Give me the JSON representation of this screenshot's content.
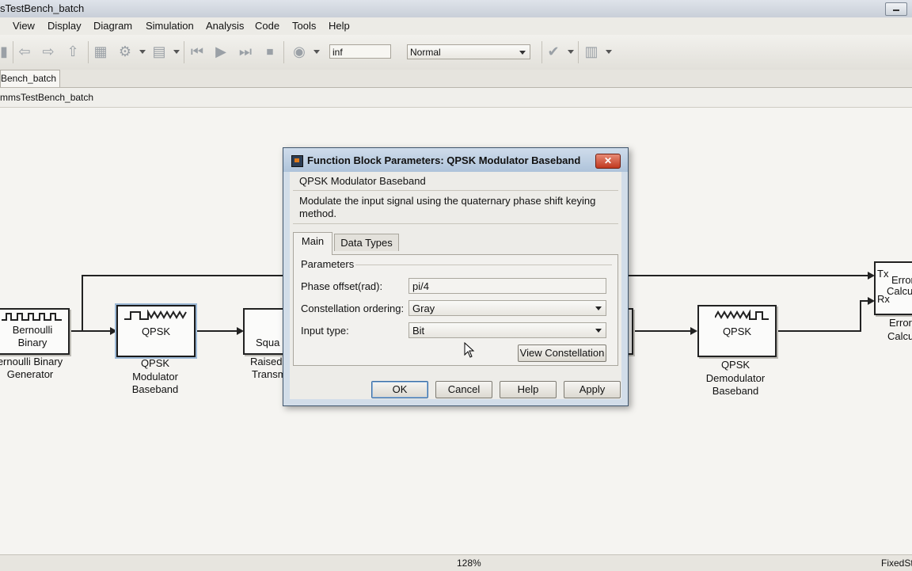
{
  "window": {
    "title": "sTestBench_batch"
  },
  "menus": [
    "View",
    "Display",
    "Diagram",
    "Simulation",
    "Analysis",
    "Code",
    "Tools",
    "Help"
  ],
  "toolbar": {
    "stop_time": "inf",
    "sim_mode": "Normal"
  },
  "tabs": {
    "model_tab": "Bench_batch"
  },
  "breadcrumb": "mmsTestBench_batch",
  "blocks": {
    "bernoulli": {
      "icon_text_1": "Bernoulli",
      "icon_text_2": "Binary",
      "label_1": "ernoulli Binary",
      "label_2": "Generator"
    },
    "qpsk_mod": {
      "icon_text": "QPSK",
      "label_1": "QPSK",
      "label_2": "Modulator",
      "label_3": "Baseband"
    },
    "raised_cosine": {
      "icon_text": "Squa",
      "label_1": "Raised",
      "label_2": "Transm"
    },
    "qpsk_demod": {
      "icon_text": "QPSK",
      "label_1": "QPSK",
      "label_2": "Demodulator",
      "label_3": "Baseband"
    },
    "error_rate": {
      "port_tx": "Tx",
      "port_rx": "Rx",
      "icon_text_1": "Error",
      "icon_text_2": "Calcu",
      "label_1": "Error",
      "label_2": "Calcu"
    }
  },
  "status": {
    "zoom": "128%",
    "solver": "FixedSt"
  },
  "dialog": {
    "title": "Function Block Parameters: QPSK Modulator Baseband",
    "block_name": "QPSK Modulator Baseband",
    "description_line1": "Modulate the input signal using the quaternary phase shift keying",
    "description_line2": "method.",
    "tabs": [
      "Main",
      "Data Types"
    ],
    "group_label": "Parameters",
    "phase_offset_label": "Phase offset(rad):",
    "phase_offset_value": "pi/4",
    "constellation_label": "Constellation ordering:",
    "constellation_value": "Gray",
    "input_type_label": "Input type:",
    "input_type_value": "Bit",
    "view_constellation": "View Constellation",
    "ok": "OK",
    "cancel": "Cancel",
    "help": "Help",
    "apply": "Apply",
    "close_glyph": "✕"
  }
}
